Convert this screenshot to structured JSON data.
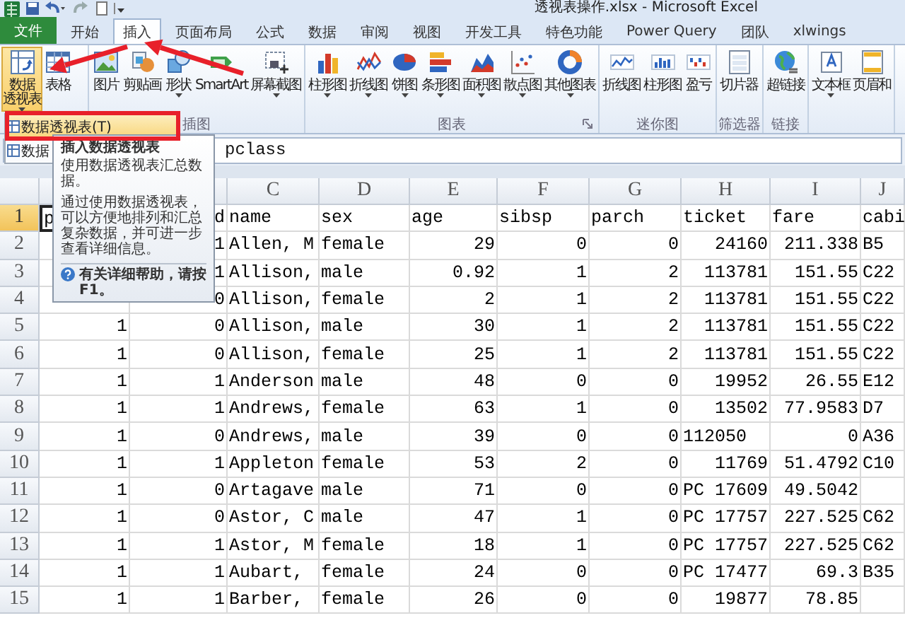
{
  "window": {
    "title": "透视表操作.xlsx - Microsoft Excel"
  },
  "tabs": [
    {
      "label": "文件",
      "kind": "file",
      "selected": false
    },
    {
      "label": "开始",
      "kind": "tab",
      "selected": false
    },
    {
      "label": "插入",
      "kind": "tab",
      "selected": true
    },
    {
      "label": "页面布局",
      "kind": "tab",
      "selected": false
    },
    {
      "label": "公式",
      "kind": "tab",
      "selected": false
    },
    {
      "label": "数据",
      "kind": "tab",
      "selected": false
    },
    {
      "label": "审阅",
      "kind": "tab",
      "selected": false
    },
    {
      "label": "视图",
      "kind": "tab",
      "selected": false
    },
    {
      "label": "开发工具",
      "kind": "tab",
      "selected": false
    },
    {
      "label": "特色功能",
      "kind": "tab",
      "selected": false
    },
    {
      "label": "Power Query",
      "kind": "tab",
      "selected": false
    },
    {
      "label": "团队",
      "kind": "tab",
      "selected": false
    },
    {
      "label": "xlwings",
      "kind": "tab",
      "selected": false
    }
  ],
  "ribbon": {
    "groups": [
      {
        "buttons": [
          {
            "label_lines": [
              "数据",
              "透视表"
            ],
            "has_menu": true,
            "pressed": true
          },
          {
            "label": "表格",
            "has_menu": false,
            "pressed": false
          }
        ]
      },
      {
        "label": "插图",
        "buttons": [
          {
            "label": "图片",
            "has_menu": false,
            "pressed": false
          },
          {
            "label": "剪贴画",
            "has_menu": false,
            "pressed": false
          },
          {
            "label": "形状",
            "has_menu": true,
            "pressed": false
          },
          {
            "label": "SmartArt",
            "has_menu": false,
            "pressed": false
          },
          {
            "label": "屏幕截图",
            "has_menu": true,
            "pressed": false
          }
        ]
      },
      {
        "label": "图表",
        "launcher": true,
        "buttons": [
          {
            "label": "柱形图",
            "has_menu": true,
            "pressed": false
          },
          {
            "label": "折线图",
            "has_menu": true,
            "pressed": false
          },
          {
            "label": "饼图",
            "has_menu": true,
            "pressed": false
          },
          {
            "label": "条形图",
            "has_menu": true,
            "pressed": false
          },
          {
            "label": "面积图",
            "has_menu": true,
            "pressed": false
          },
          {
            "label": "散点图",
            "has_menu": true,
            "pressed": false
          },
          {
            "label": "其他图表",
            "has_menu": true,
            "pressed": false
          }
        ]
      },
      {
        "label": "迷你图",
        "buttons": [
          {
            "label": "折线图",
            "has_menu": false,
            "pressed": false
          },
          {
            "label": "柱形图",
            "has_menu": false,
            "pressed": false
          },
          {
            "label": "盈亏",
            "has_menu": false,
            "pressed": false
          }
        ]
      },
      {
        "label": "筛选器",
        "buttons": [
          {
            "label": "切片器",
            "has_menu": false,
            "pressed": false
          }
        ]
      },
      {
        "label": "链接",
        "buttons": [
          {
            "label": "超链接",
            "has_menu": false,
            "pressed": false
          }
        ]
      },
      {
        "buttons": [
          {
            "label": "文本框",
            "has_menu": true,
            "pressed": false
          },
          {
            "label": "页眉和",
            "has_menu": false,
            "pressed": false
          }
        ]
      }
    ]
  },
  "formula_bar": {
    "value": "pclass"
  },
  "dropdown_menu": {
    "items": [
      {
        "label": "数据透视表(T)",
        "highlighted": true
      },
      {
        "label": "数据",
        "highlighted": false
      }
    ]
  },
  "tooltip": {
    "title": "插入数据透视表",
    "description": "使用数据透视表汇总数据。",
    "details": "通过使用数据透视表，可以方便地排列和汇总复杂数据，并可进一步查看详细信息。",
    "help": "有关详细帮助，请按 F1。"
  },
  "sheet": {
    "columns": [
      {
        "kind": "number"
      },
      {
        "kind": "number"
      },
      {
        "header": "C",
        "kind": "text"
      },
      {
        "header": "D",
        "kind": "text"
      },
      {
        "header": "E",
        "kind": "number"
      },
      {
        "header": "F",
        "kind": "number"
      },
      {
        "header": "G",
        "kind": "number"
      },
      {
        "header": "H",
        "kind": "number"
      },
      {
        "header": "I",
        "kind": "number"
      },
      {
        "header": "J",
        "kind": "text"
      }
    ],
    "rows": [
      {
        "header": "1",
        "selected": true,
        "cells": [
          {
            "text": "p",
            "kind": "text"
          },
          {
            "text": "d",
            "kind": "number"
          },
          "name",
          "sex",
          {
            "text": "age",
            "kind": "text"
          },
          {
            "text": "sibsp",
            "kind": "text"
          },
          {
            "text": "parch",
            "kind": "text"
          },
          {
            "text": "ticket",
            "kind": "text"
          },
          {
            "text": "fare",
            "kind": "text"
          },
          "cabi"
        ]
      },
      {
        "header": "2",
        "selected": false,
        "cells": [
          null,
          "1",
          "Allen, M",
          "female",
          "29",
          "0",
          "0",
          "24160",
          "211.338",
          "B5"
        ]
      },
      {
        "header": "3",
        "selected": false,
        "cells": [
          null,
          "1",
          "Allison,",
          "male",
          "0.92",
          "1",
          "2",
          "113781",
          "151.55",
          "C22"
        ]
      },
      {
        "header": "4",
        "selected": false,
        "cells": [
          null,
          "0",
          "Allison,",
          "female",
          "2",
          "1",
          "2",
          "113781",
          "151.55",
          "C22"
        ]
      },
      {
        "header": "5",
        "selected": false,
        "cells": [
          "1",
          "0",
          "Allison,",
          "male",
          "30",
          "1",
          "2",
          "113781",
          "151.55",
          "C22"
        ]
      },
      {
        "header": "6",
        "selected": false,
        "cells": [
          "1",
          "0",
          "Allison,",
          "female",
          "25",
          "1",
          "2",
          "113781",
          "151.55",
          "C22"
        ]
      },
      {
        "header": "7",
        "selected": false,
        "cells": [
          "1",
          "1",
          "Anderson",
          "male",
          "48",
          "0",
          "0",
          "19952",
          "26.55",
          "E12"
        ]
      },
      {
        "header": "8",
        "selected": false,
        "cells": [
          "1",
          "1",
          "Andrews,",
          "female",
          "63",
          "1",
          "0",
          "13502",
          "77.9583",
          "D7"
        ]
      },
      {
        "header": "9",
        "selected": false,
        "cells": [
          "1",
          "0",
          "Andrews,",
          "male",
          "39",
          "0",
          "0",
          {
            "text": "112050",
            "kind": "text"
          },
          "0",
          "A36"
        ]
      },
      {
        "header": "10",
        "selected": false,
        "cells": [
          "1",
          "1",
          "Appleton",
          "female",
          "53",
          "2",
          "0",
          "11769",
          "51.4792",
          "C10"
        ]
      },
      {
        "header": "11",
        "selected": false,
        "cells": [
          "1",
          "0",
          "Artagave",
          "male",
          "71",
          "0",
          "0",
          {
            "text": "PC 17609",
            "kind": "text"
          },
          "49.5042",
          null
        ]
      },
      {
        "header": "12",
        "selected": false,
        "cells": [
          "1",
          "0",
          "Astor, C",
          "male",
          "47",
          "1",
          "0",
          {
            "text": "PC 17757",
            "kind": "text"
          },
          "227.525",
          "C62"
        ]
      },
      {
        "header": "13",
        "selected": false,
        "cells": [
          "1",
          "1",
          "Astor, M",
          "female",
          "18",
          "1",
          "0",
          {
            "text": "PC 17757",
            "kind": "text"
          },
          "227.525",
          "C62"
        ]
      },
      {
        "header": "14",
        "selected": false,
        "cells": [
          "1",
          "1",
          "Aubart,",
          "female",
          "24",
          "0",
          "0",
          {
            "text": "PC 17477",
            "kind": "text"
          },
          "69.3",
          "B35"
        ]
      },
      {
        "header": "15",
        "selected": false,
        "cells": [
          "1",
          "1",
          "Barber,",
          "female",
          "26",
          "0",
          "0",
          "19877",
          "78.85",
          null
        ]
      }
    ]
  }
}
